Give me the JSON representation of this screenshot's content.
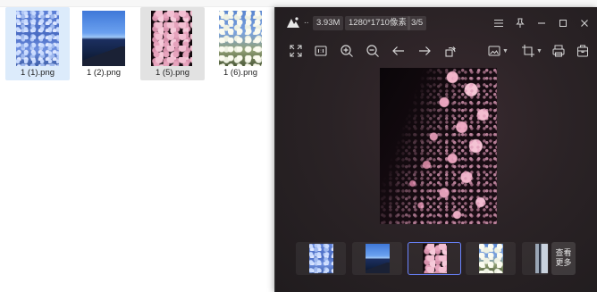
{
  "explorer": {
    "files": [
      {
        "name": "1 (1).png",
        "state": "selected",
        "photo": "blue-flowers"
      },
      {
        "name": "1 (2).png",
        "state": "normal",
        "photo": "seaside-dusk"
      },
      {
        "name": "1 (5).png",
        "state": "hover",
        "photo": "pink-blossom-night"
      },
      {
        "name": "1 (6).png",
        "state": "normal",
        "photo": "white-blossom-sky"
      }
    ]
  },
  "viewer": {
    "dots": "..",
    "file_size": "3.93M",
    "resolution": "1280*1710像素",
    "position": "3/5",
    "toolbar_icons": [
      "fullscreen-icon",
      "original-size-icon",
      "zoom-in-icon",
      "zoom-out-icon",
      "previous-icon",
      "next-icon",
      "rotate-icon",
      "image-edit-icon",
      "crop-icon",
      "print-icon",
      "save-icon"
    ],
    "window_icons": [
      "menu-icon",
      "pin-icon",
      "minimize-icon",
      "maximize-icon",
      "close-icon"
    ],
    "filmstrip": [
      {
        "photo": "blue-flowers",
        "current": false
      },
      {
        "photo": "seaside-dusk",
        "current": false
      },
      {
        "photo": "pink-blossom-night",
        "current": true
      },
      {
        "photo": "white-blossom-sky",
        "current": false
      },
      {
        "photo": "partial-image",
        "current": false
      }
    ],
    "more_label": "查看\n更多",
    "accent": "#6a84ff"
  }
}
